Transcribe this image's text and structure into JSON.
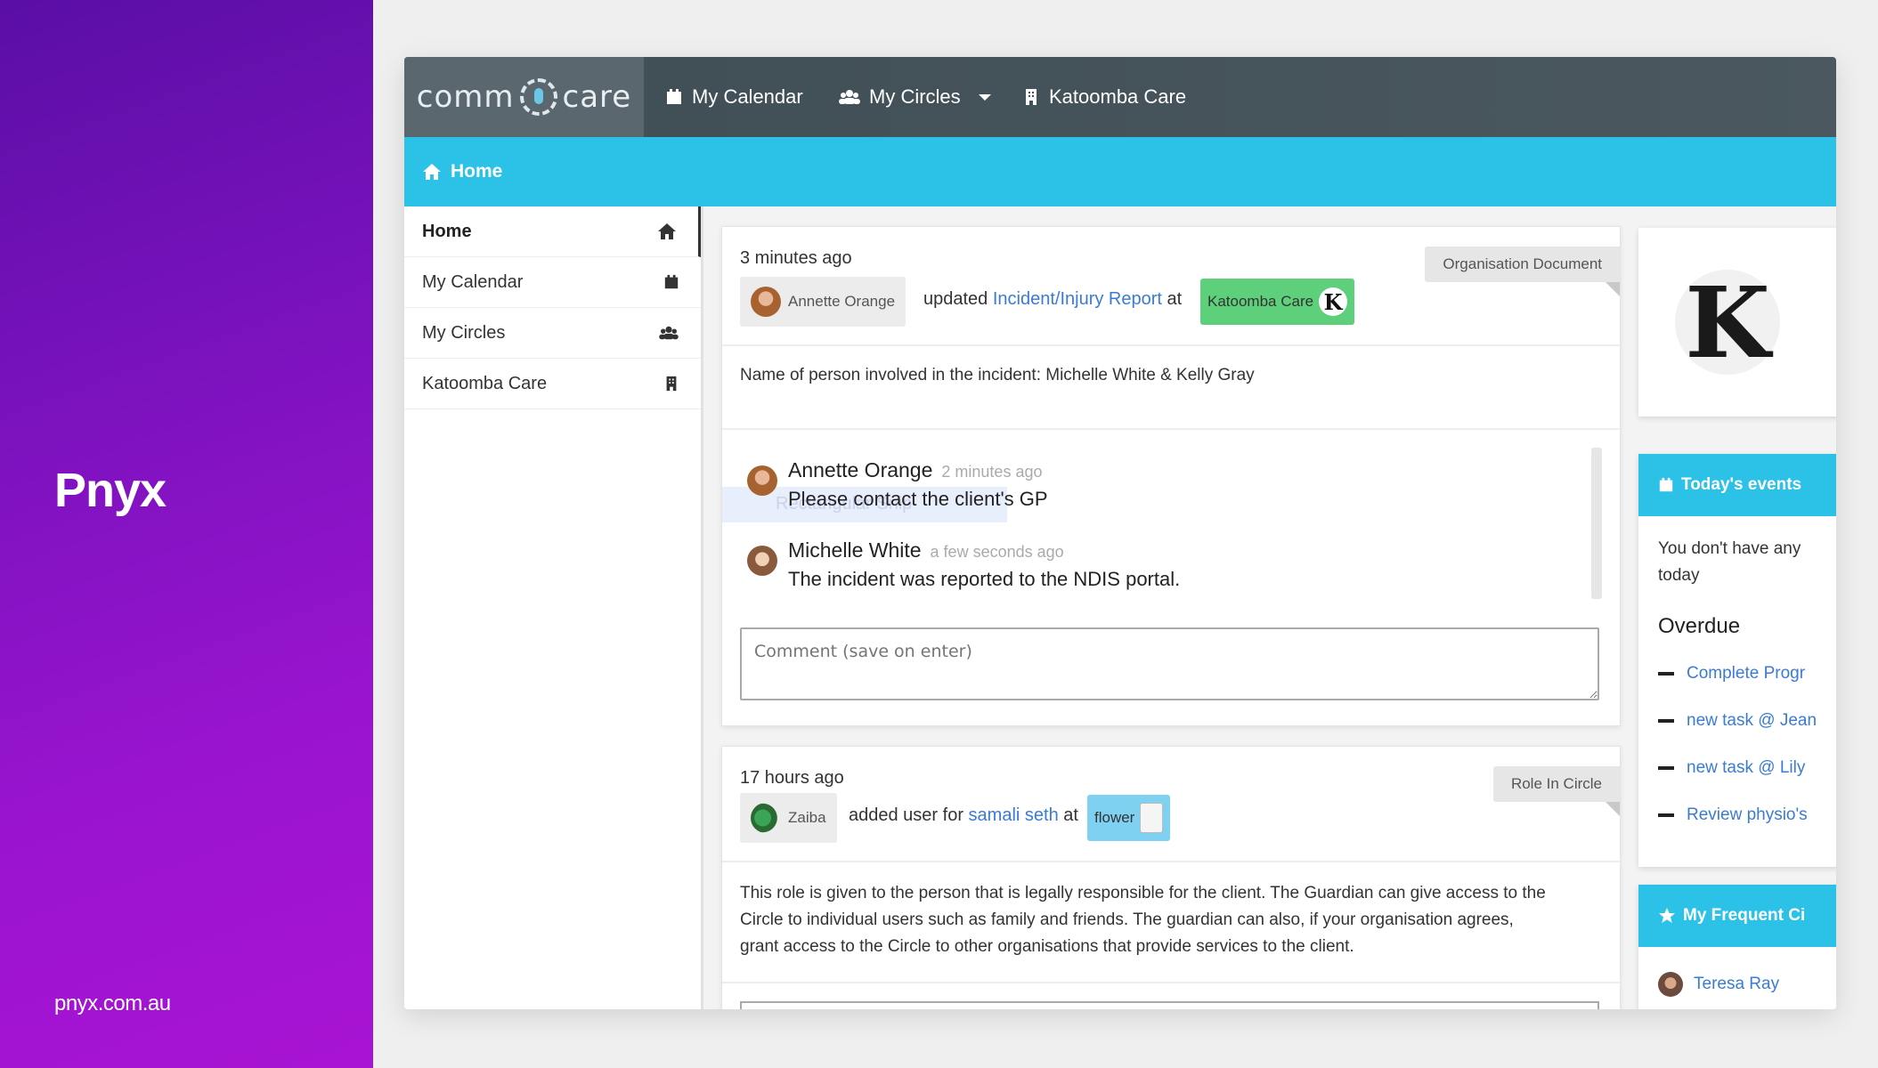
{
  "brand": {
    "title": "Pnyx",
    "url": "pnyx.com.au"
  },
  "topbar": {
    "logo_left": "comm",
    "logo_right": "care",
    "nav": [
      {
        "label": "My Calendar",
        "icon": "calendar-icon"
      },
      {
        "label": "My Circles",
        "icon": "group-icon"
      },
      {
        "label": "Katoomba Care",
        "icon": "building-icon"
      }
    ]
  },
  "subbar": {
    "label": "Home",
    "icon": "home-icon"
  },
  "sidebar": {
    "items": [
      {
        "label": "Home",
        "icon": "home-icon",
        "active": true
      },
      {
        "label": "My Calendar",
        "icon": "calendar-icon"
      },
      {
        "label": "My Circles",
        "icon": "group-icon"
      },
      {
        "label": "Katoomba Care",
        "icon": "building-icon"
      }
    ]
  },
  "feed": [
    {
      "time": "3 minutes ago",
      "badge": "Organisation Document",
      "user": "Annette Orange",
      "verb": "updated",
      "link": "Incident/Injury Report",
      "at": "at",
      "org_tag": "Katoomba Care",
      "body": "Name of person involved in the incident: Michelle White & Kelly Gray",
      "comments": [
        {
          "name": "Annette Orange",
          "ago": "2 minutes ago",
          "text": "Please contact the client's GP"
        },
        {
          "name": "Michelle White",
          "ago": "a few seconds ago",
          "text": "The incident was reported to the NDIS portal."
        }
      ],
      "comment_placeholder": "Comment (save on enter)",
      "ghost_text": "Rectangular Snip"
    },
    {
      "time": "17 hours ago",
      "badge": "Role In Circle",
      "user": "Zaiba",
      "verb": "added user for",
      "link": "samali seth",
      "at": "at",
      "org_tag": "flower",
      "body_lines": [
        "This role is given to the person that is legally responsible for the client. The Guardian can give access to the",
        "Circle to individual users such as family and friends. The guardian can also, if your organisation agrees,",
        "grant access to the Circle to other organisations that provide services to the client."
      ]
    }
  ],
  "right": {
    "events_title": "Today's events",
    "no_events_line1": "You don't have any",
    "no_events_line2": "today",
    "overdue_title": "Overdue",
    "overdue_items": [
      "Complete Progr",
      "new task @ Jean",
      "new task @ Lily",
      "Review physio's"
    ],
    "frequent_title": "My Frequent Ci",
    "frequent_items": [
      "Teresa Ray"
    ]
  },
  "colors": {
    "accent": "#2cc1e6",
    "topbar": "#434f56",
    "brand_purple": "#8a12c6",
    "link": "#3a7bd5",
    "tag_green": "#5ed07c",
    "tag_blue": "#7fd1f2"
  }
}
